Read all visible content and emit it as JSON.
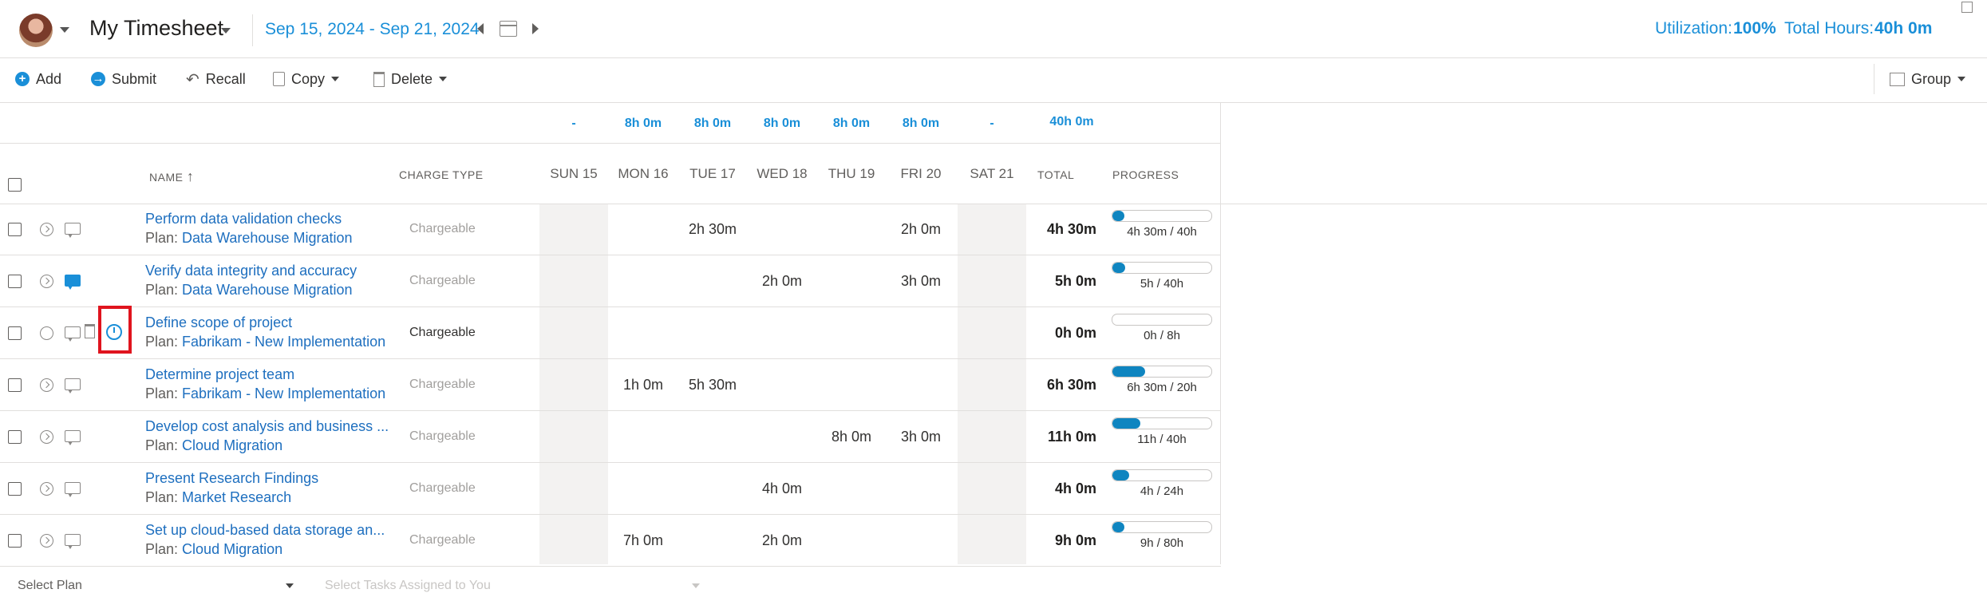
{
  "header": {
    "title": "My Timesheet",
    "date_range": "Sep 15, 2024 - Sep 21, 2024",
    "utilization_label": "Utilization:",
    "utilization_value": "100%",
    "total_hours_label": "Total Hours:",
    "total_hours_value": "40h 0m"
  },
  "toolbar": {
    "add": "Add",
    "submit": "Submit",
    "recall": "Recall",
    "copy": "Copy",
    "delete": "Delete",
    "group": "Group"
  },
  "summary": [
    "-",
    "8h 0m",
    "8h 0m",
    "8h 0m",
    "8h 0m",
    "8h 0m",
    "-",
    "40h 0m"
  ],
  "columns": {
    "name": "NAME",
    "charge_type": "CHARGE TYPE",
    "days": [
      "SUN 15",
      "MON 16",
      "TUE 17",
      "WED 18",
      "THU 19",
      "FRI 20",
      "SAT 21"
    ],
    "total": "TOTAL",
    "progress": "PROGRESS"
  },
  "plan_prefix": "Plan:",
  "rows": [
    {
      "task": "Perform data validation checks",
      "plan": "Data Warehouse Migration",
      "charge": "Chargeable",
      "days": [
        "",
        "",
        "2h 30m",
        "",
        "",
        "2h 0m",
        ""
      ],
      "total": "4h 30m",
      "progress": "4h 30m / 40h",
      "progress_fraction": 0.11
    },
    {
      "task": "Verify data integrity and accuracy",
      "plan": "Data Warehouse Migration",
      "charge": "Chargeable",
      "days": [
        "",
        "",
        "",
        "2h 0m",
        "",
        "3h 0m",
        ""
      ],
      "total": "5h 0m",
      "progress": "5h / 40h",
      "progress_fraction": 0.13
    },
    {
      "task": "Define scope of project",
      "plan": "Fabrikam - New Implementation",
      "charge": "Chargeable",
      "days": [
        "",
        "",
        "",
        "",
        "",
        "",
        ""
      ],
      "total": "0h 0m",
      "progress": "0h / 8h",
      "progress_fraction": 0.0
    },
    {
      "task": "Determine project team",
      "plan": "Fabrikam - New Implementation",
      "charge": "Chargeable",
      "days": [
        "",
        "1h 0m",
        "5h 30m",
        "",
        "",
        "",
        ""
      ],
      "total": "6h 30m",
      "progress": "6h 30m / 20h",
      "progress_fraction": 0.33
    },
    {
      "task": "Develop cost analysis and business ...",
      "plan": "Cloud Migration",
      "charge": "Chargeable",
      "days": [
        "",
        "",
        "",
        "",
        "8h 0m",
        "3h 0m",
        ""
      ],
      "total": "11h 0m",
      "progress": "11h / 40h",
      "progress_fraction": 0.28
    },
    {
      "task": "Present Research Findings",
      "plan": "Market Research",
      "charge": "Chargeable",
      "days": [
        "",
        "",
        "",
        "4h 0m",
        "",
        "",
        ""
      ],
      "total": "4h 0m",
      "progress": "4h / 24h",
      "progress_fraction": 0.17
    },
    {
      "task": "Set up cloud-based data storage an...",
      "plan": "Cloud Migration",
      "charge": "Chargeable",
      "days": [
        "",
        "7h 0m",
        "",
        "2h 0m",
        "",
        "",
        ""
      ],
      "total": "9h 0m",
      "progress": "9h / 80h",
      "progress_fraction": 0.11
    }
  ],
  "footer": {
    "select_plan": "Select Plan",
    "select_tasks": "Select Tasks Assigned to You"
  },
  "colors": {
    "accent": "#1a8fd8",
    "link": "#1e6fbf",
    "progress": "#0f85c0",
    "highlight": "#e0141e"
  }
}
